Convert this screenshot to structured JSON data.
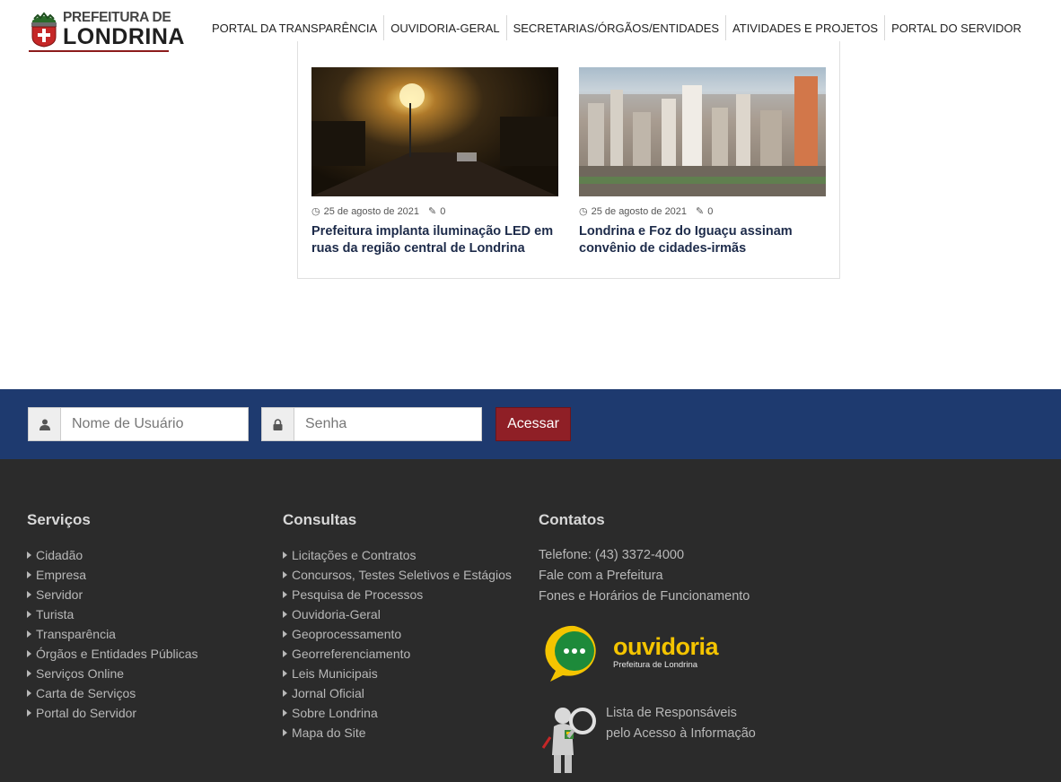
{
  "header": {
    "logo": {
      "line1": "PREFEITURA DE",
      "line2": "LONDRINA"
    },
    "nav": [
      {
        "label": "PORTAL DA TRANSPARÊNCIA"
      },
      {
        "label": "OUVIDORIA-GERAL"
      },
      {
        "label": "SECRETARIAS/ÓRGÃOS/ENTIDADES"
      },
      {
        "label": "ATIVIDADES E PROJETOS"
      },
      {
        "label": "PORTAL DO SERVIDOR"
      }
    ]
  },
  "news": [
    {
      "date": "25 de agosto de 2021",
      "comments": "0",
      "title": "Prefeitura implanta iluminação LED em ruas da região central de Londrina"
    },
    {
      "date": "25 de agosto de 2021",
      "comments": "0",
      "title": "Londrina e Foz do Iguaçu assinam convênio de cidades-irmãs"
    }
  ],
  "login": {
    "username_placeholder": "Nome de Usuário",
    "username_value": "",
    "password_placeholder": "Senha",
    "password_value": "",
    "submit_label": "Acessar"
  },
  "footer": {
    "servicos": {
      "title": "Serviços",
      "items": [
        "Cidadão",
        "Empresa",
        "Servidor",
        "Turista",
        "Transparência",
        "Órgãos e Entidades Públicas",
        "Serviços Online",
        "Carta de Serviços",
        "Portal do Servidor"
      ]
    },
    "consultas": {
      "title": "Consultas",
      "items": [
        "Licitações e Contratos",
        "Concursos, Testes Seletivos e Estágios",
        "Pesquisa de Processos",
        "Ouvidoria-Geral",
        "Geoprocessamento",
        "Georreferenciamento",
        "Leis Municipais",
        "Jornal Oficial",
        "Sobre Londrina",
        "Mapa do Site"
      ]
    },
    "contatos": {
      "title": "Contatos",
      "lines": [
        "Telefone: (43) 3372-4000",
        "Fale com a Prefeitura",
        "Fones e Horários de Funcionamento"
      ],
      "ouvidoria_word": "ouvidoria",
      "ouvidoria_sub": "Prefeitura de Londrina",
      "lista_line1": "Lista de Responsáveis",
      "lista_line2": "pelo Acesso à Informação"
    }
  },
  "colors": {
    "login_bar": "#1e3a6f",
    "accent_button": "#8f1f26",
    "footer_bg": "#2b2b2b",
    "title_text": "#1d2b4a",
    "ouvidoria_yellow": "#f4c400",
    "ouvidoria_green": "#1d8a3a"
  },
  "icons": {
    "user": "user-icon",
    "lock": "lock-icon",
    "clock": "clock-icon",
    "comments": "comments-icon",
    "caret": "caret-right-icon"
  }
}
